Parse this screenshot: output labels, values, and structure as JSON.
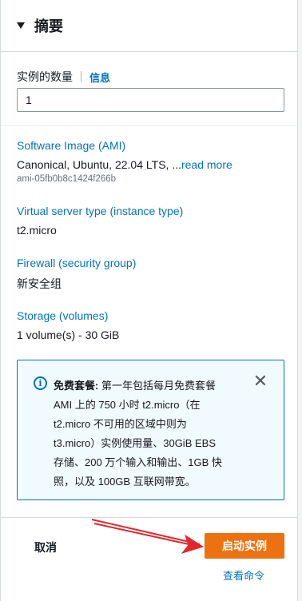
{
  "summary": {
    "title": "摘要"
  },
  "instances": {
    "label": "实例的数量",
    "info": "信息",
    "value": "1"
  },
  "ami": {
    "label": "Software Image (AMI)",
    "value": "Canonical, Ubuntu, 22.04 LTS, ...",
    "read_more": "read more",
    "id": "ami-05fb0b8c1424f266b"
  },
  "instance_type": {
    "label": "Virtual server type (instance type)",
    "value": "t2.micro"
  },
  "firewall": {
    "label": "Firewall (security group)",
    "value": "新安全组"
  },
  "storage": {
    "label": "Storage (volumes)",
    "value": "1 volume(s) - 30 GiB"
  },
  "free_tier": {
    "heading": "免费套餐:",
    "line1": "第一年包括每月免费套餐",
    "line2": "AMI 上的 750 小时 t2.micro（在",
    "line3": "t2.micro 不可用的区域中则为",
    "line4": "t3.micro）实例使用量、30GiB EBS",
    "line5": "存储、200 万个输入和输出、1GB 快",
    "line6": "照，以及 100GB 互联网带宽。",
    "icon": "info-icon",
    "close_icon": "close-icon"
  },
  "footer": {
    "cancel": "取消",
    "launch": "启动实例",
    "view_commands": "查看命令"
  },
  "colors": {
    "link": "#0073bb",
    "primary_button": "#ec7211",
    "annotation_arrow": "#e3262b"
  }
}
